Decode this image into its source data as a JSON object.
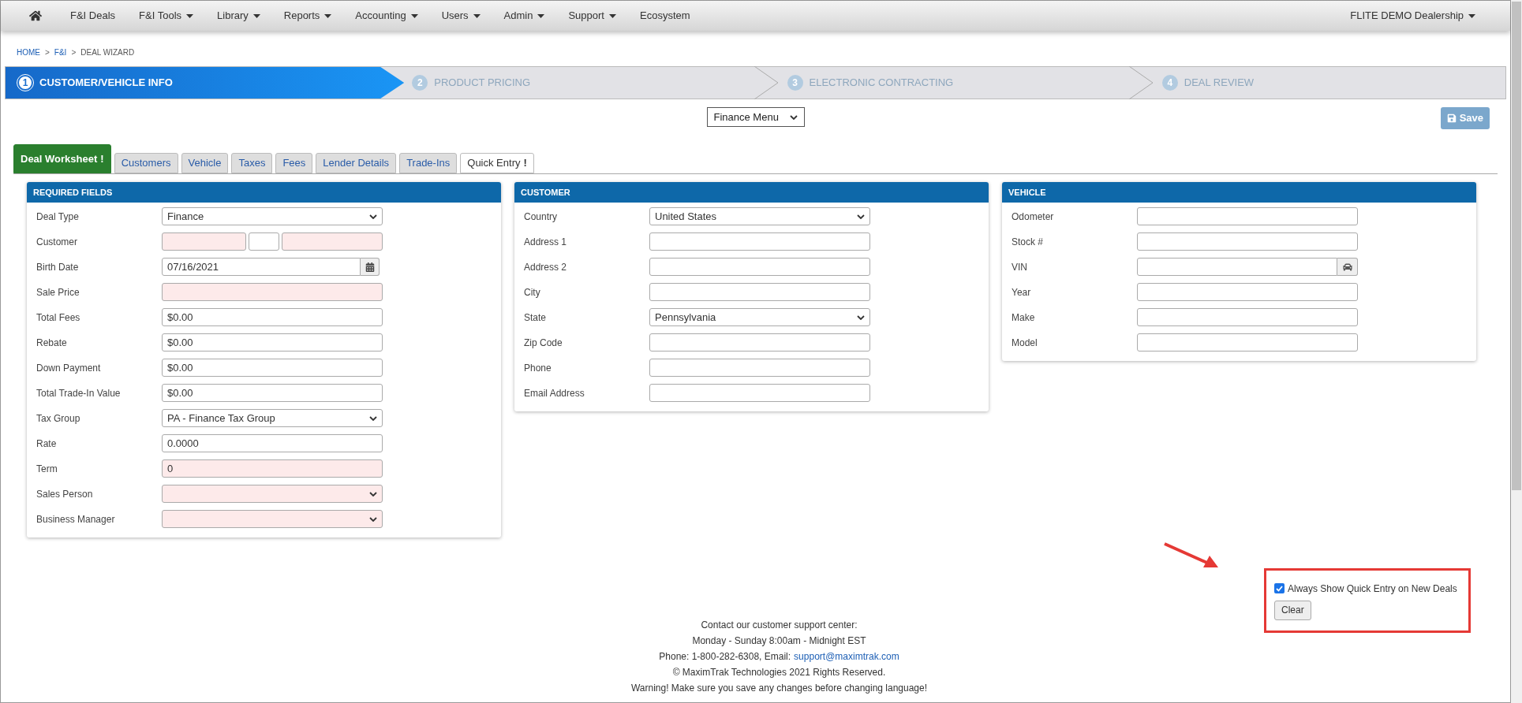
{
  "nav": {
    "items": [
      {
        "label": "F&I Deals",
        "dropdown": false
      },
      {
        "label": "F&I Tools",
        "dropdown": true
      },
      {
        "label": "Library",
        "dropdown": true
      },
      {
        "label": "Reports",
        "dropdown": true
      },
      {
        "label": "Accounting",
        "dropdown": true
      },
      {
        "label": "Users",
        "dropdown": true
      },
      {
        "label": "Admin",
        "dropdown": true
      },
      {
        "label": "Support",
        "dropdown": true
      },
      {
        "label": "Ecosystem",
        "dropdown": false
      }
    ],
    "dealership": "FLITE DEMO Dealership"
  },
  "breadcrumb_separator": ">",
  "breadcrumb": [
    {
      "label": "HOME",
      "link": true
    },
    {
      "label": "F&I",
      "link": true
    },
    {
      "label": "DEAL WIZARD",
      "link": false
    }
  ],
  "wizard": [
    {
      "number": "1",
      "label": "CUSTOMER/VEHICLE INFO",
      "selected": true
    },
    {
      "number": "2",
      "label": "PRODUCT PRICING",
      "selected": false
    },
    {
      "number": "3",
      "label": "ELECTRONIC CONTRACTING",
      "selected": false
    },
    {
      "number": "4",
      "label": "DEAL REVIEW",
      "selected": false
    }
  ],
  "menu_select": "Finance Menu",
  "save_button": "Save",
  "tabs": [
    {
      "label": "Deal Worksheet",
      "alert": "!",
      "selected": true
    },
    {
      "label": "Customers",
      "selected": false
    },
    {
      "label": "Vehicle",
      "selected": false
    },
    {
      "label": "Taxes",
      "selected": false
    },
    {
      "label": "Fees",
      "selected": false
    },
    {
      "label": "Lender Details",
      "selected": false
    },
    {
      "label": "Trade-Ins",
      "selected": false
    },
    {
      "label": "Quick Entry",
      "alert": "!",
      "selected": false
    }
  ],
  "panels": [
    {
      "title": "REQUIRED FIELDS",
      "fields": [
        {
          "label": "Deal Type",
          "kind": "select",
          "value": "Finance",
          "required": false
        },
        {
          "label": "Customer",
          "kind": "name",
          "required": true
        },
        {
          "label": "Birth Date",
          "kind": "date",
          "value": "07/16/2021",
          "required": false
        },
        {
          "label": "Sale Price",
          "kind": "input",
          "required": true
        },
        {
          "label": "Total Fees",
          "kind": "input",
          "value": "$0.00",
          "required": false
        },
        {
          "label": "Rebate",
          "kind": "input",
          "value": "$0.00",
          "required": false
        },
        {
          "label": "Down Payment",
          "kind": "input",
          "value": "$0.00",
          "required": false
        },
        {
          "label": "Total Trade-In Value",
          "kind": "input",
          "value": "$0.00",
          "required": false
        },
        {
          "label": "Tax Group",
          "kind": "select",
          "value": "PA - Finance Tax Group",
          "required": false
        },
        {
          "label": "Rate",
          "kind": "input",
          "value": "0.0000",
          "required": false
        },
        {
          "label": "Term",
          "kind": "input",
          "value": "0",
          "required": true
        },
        {
          "label": "Sales Person",
          "kind": "select",
          "required": true
        },
        {
          "label": "Business Manager",
          "kind": "select",
          "required": true
        }
      ]
    },
    {
      "title": "CUSTOMER",
      "fields": [
        {
          "label": "Country",
          "kind": "select",
          "value": "United States",
          "required": false
        },
        {
          "label": "Address 1",
          "kind": "input",
          "required": false
        },
        {
          "label": "Address 2",
          "kind": "input",
          "required": false
        },
        {
          "label": "City",
          "kind": "input",
          "required": false
        },
        {
          "label": "State",
          "kind": "select",
          "value": "Pennsylvania",
          "required": false
        },
        {
          "label": "Zip Code",
          "kind": "input",
          "required": false
        },
        {
          "label": "Phone",
          "kind": "input",
          "required": false
        },
        {
          "label": "Email Address",
          "kind": "input",
          "required": false
        }
      ]
    },
    {
      "title": "VEHICLE",
      "fields": [
        {
          "label": "Odometer",
          "kind": "input",
          "required": false
        },
        {
          "label": "Stock #",
          "kind": "input",
          "required": false
        },
        {
          "label": "VIN",
          "kind": "vin",
          "required": false
        },
        {
          "label": "Year",
          "kind": "input",
          "required": false
        },
        {
          "label": "Make",
          "kind": "input",
          "required": false
        },
        {
          "label": "Model",
          "kind": "input",
          "required": false
        }
      ]
    }
  ],
  "quick_entry": {
    "label": "Always Show Quick Entry on New Deals",
    "checked": true,
    "button": "Clear"
  },
  "footer": {
    "lines": [
      "Contact our customer support center:",
      "Monday - Sunday 8:00am - Midnight EST"
    ],
    "phone": "Phone: 1-800-282-6308, Email:",
    "email": "support@maximtrak.com",
    "copyright": "© MaximTrak Technologies 2021 Rights Reserved.",
    "warning": "Warning! Make sure you save any changes before changing language!"
  }
}
